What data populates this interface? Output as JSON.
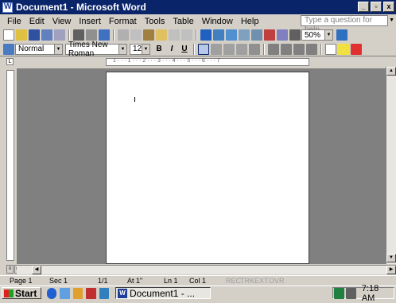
{
  "window": {
    "title": "Document1 - Microsoft Word",
    "min": "_",
    "max": "▫",
    "close": "x"
  },
  "menu": [
    "File",
    "Edit",
    "View",
    "Insert",
    "Format",
    "Tools",
    "Table",
    "Window",
    "Help"
  ],
  "ask": {
    "placeholder": "Type a question for help"
  },
  "standard_toolbar": {
    "zoom": "50%"
  },
  "formatting_toolbar": {
    "style": "Normal",
    "font": "Times New Roman",
    "size": "12",
    "bold": "B",
    "italic": "I",
    "underline": "U"
  },
  "status": {
    "page": "Page 1",
    "sec": "Sec 1",
    "pages": "1/1",
    "at": "At 1\"",
    "ln": "Ln 1",
    "col": "Col 1",
    "rec": "REC",
    "trk": "TRK",
    "ext": "EXT",
    "ovr": "OVR"
  },
  "taskbar": {
    "start": "Start",
    "doc": "Document1 - ...",
    "clock": "7:18 AM"
  },
  "ruler": {
    "h_marks": "1 · · · 1 · · · 2 · · · 3 · · · 4 · · · 5 · · · 6 · · · 7"
  },
  "colors": {
    "titlebar": "#0a246a",
    "workspace": "#808080",
    "page": "#ffffff"
  }
}
